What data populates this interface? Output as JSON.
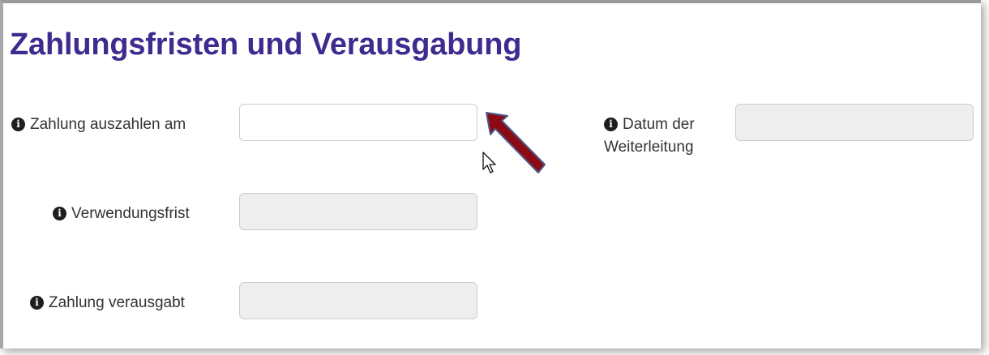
{
  "section": {
    "title": "Zahlungsfristen und Verausgabung"
  },
  "fields": {
    "auszahlen": {
      "label": "Zahlung auszahlen am",
      "value": ""
    },
    "weiterleitung": {
      "label_line1": "Datum der",
      "label_line2": "Weiterleitung",
      "value": ""
    },
    "verwendungsfrist": {
      "label": "Verwendungsfrist",
      "value": ""
    },
    "verausgabt": {
      "label": "Zahlung verausgabt",
      "value": ""
    }
  },
  "icons": {
    "info": "info-circle-icon",
    "info_glyph": "i",
    "annotation": "red-arrow-icon",
    "cursor": "mouse-pointer-icon"
  },
  "colors": {
    "title": "#3f2b8f",
    "disabled_field": "#eeeeee",
    "field_border": "#cccccc",
    "arrow": "#8b0a14"
  }
}
